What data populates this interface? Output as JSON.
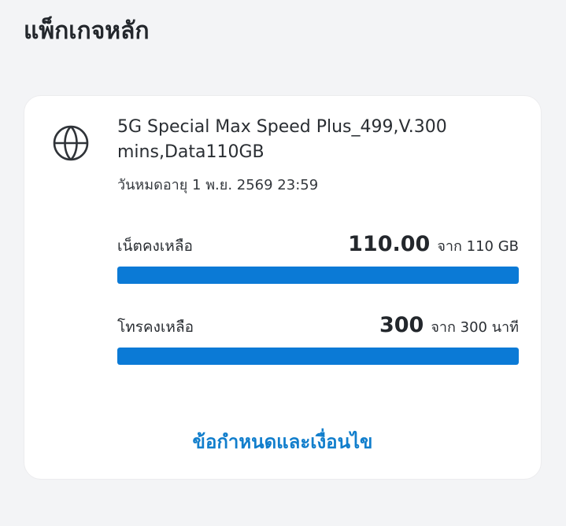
{
  "section": {
    "title": "แพ็กเกจหลัก"
  },
  "package": {
    "icon": "globe-icon",
    "name": "5G Special Max Speed Plus_499,V.300 mins,Data110GB",
    "expiry": "วันหมดอายุ 1 พ.ย. 2569 23:59",
    "data": {
      "label": "เน็ตคงเหลือ",
      "amount": "110.00",
      "total": "จาก 110 GB",
      "remaining_fraction": 1.0
    },
    "voice": {
      "label": "โทรคงเหลือ",
      "amount": "300",
      "total": "จาก 300 นาที",
      "remaining_fraction": 1.0
    },
    "terms_label": "ข้อกำหนดและเงื่อนไข"
  },
  "colors": {
    "accent": "#0b7ad6",
    "link": "#117ecc"
  }
}
